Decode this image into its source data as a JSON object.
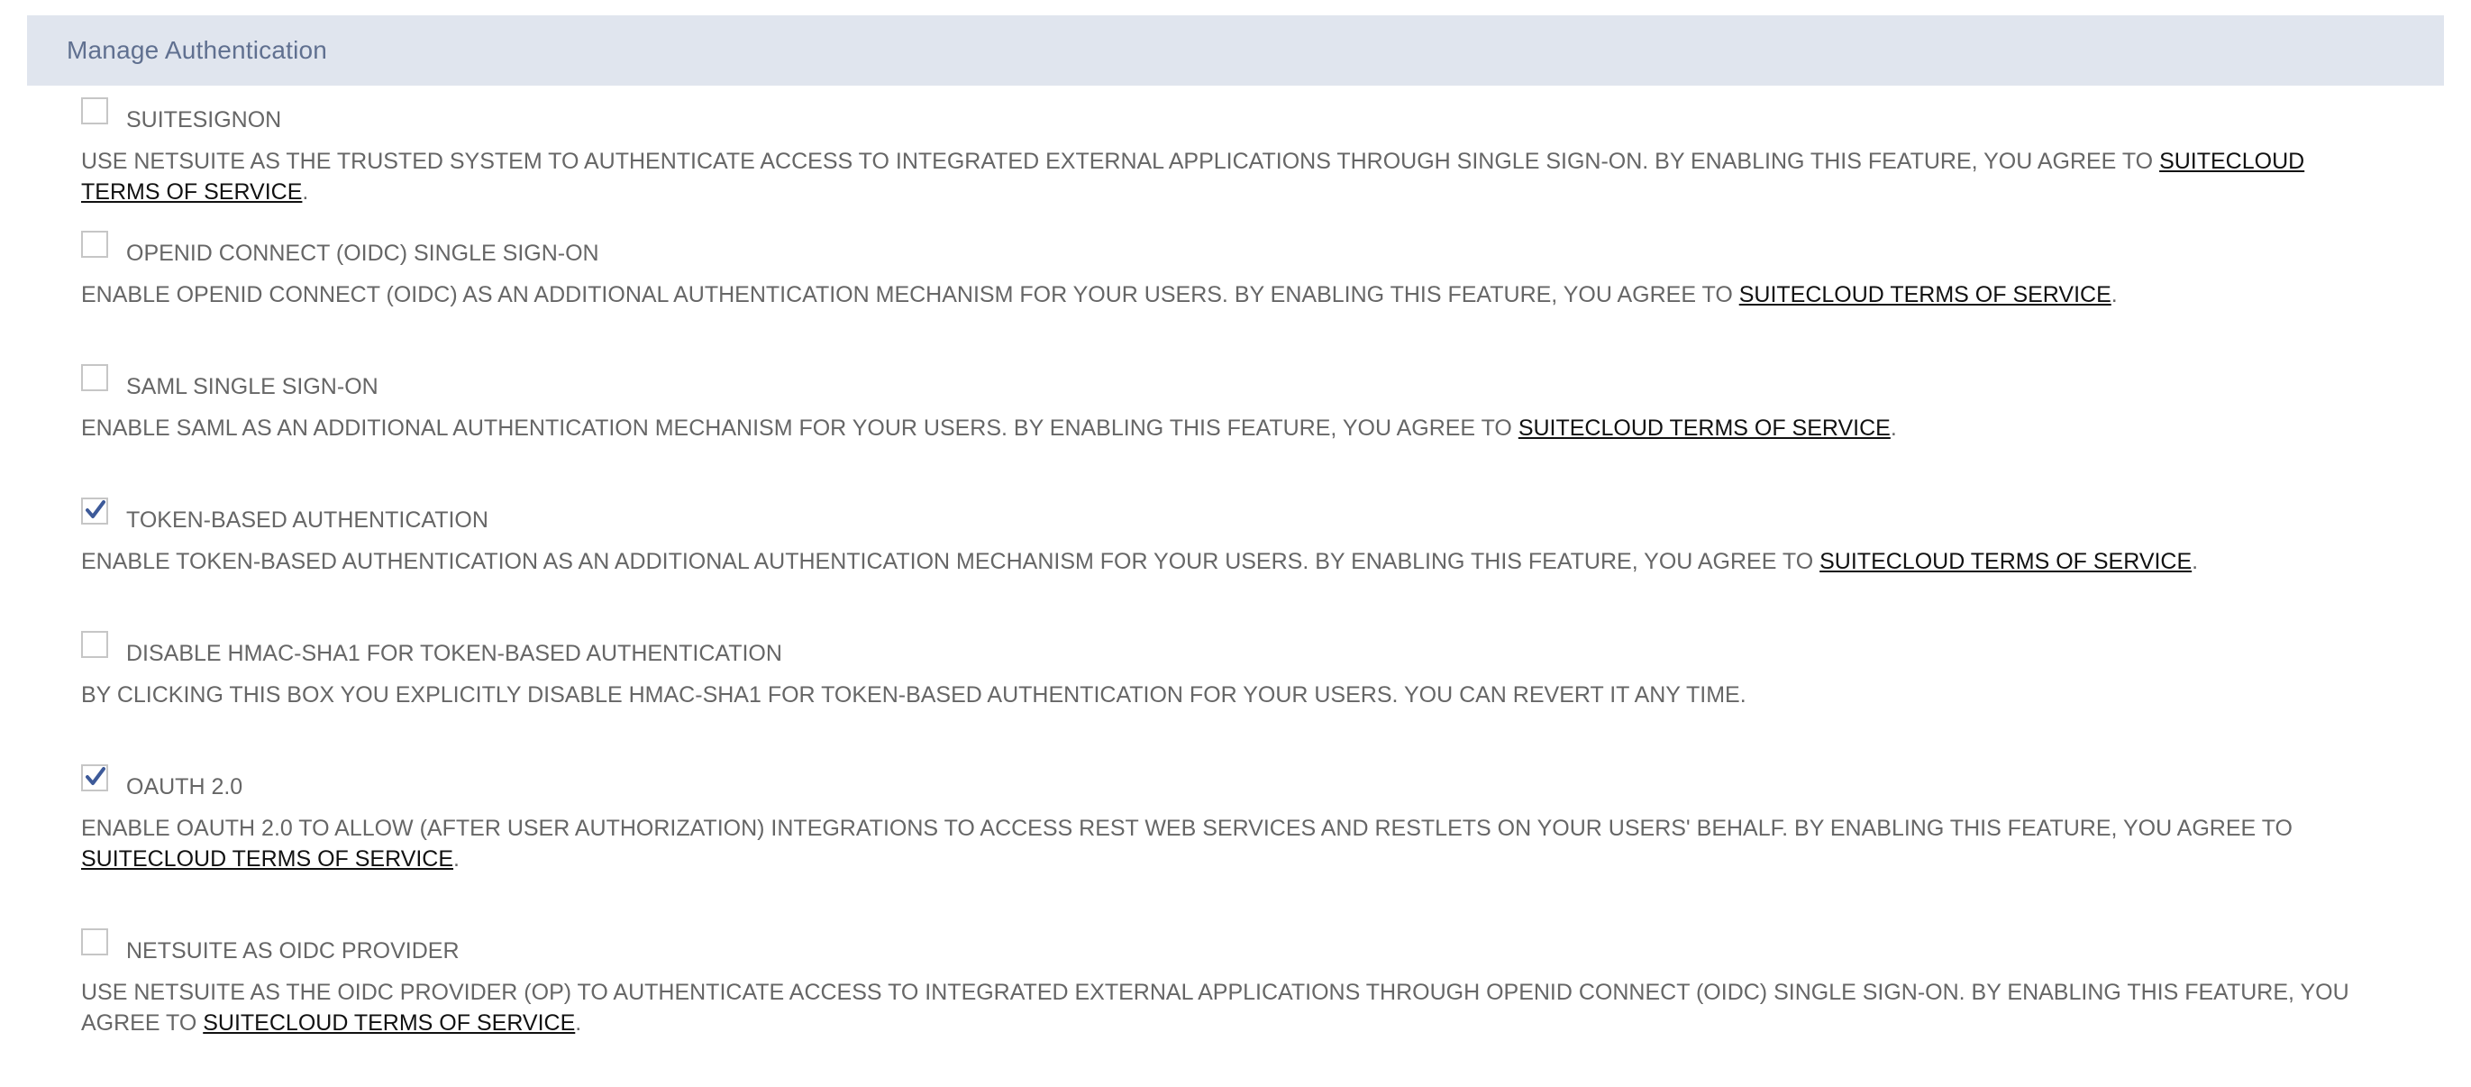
{
  "section": {
    "title": "Manage Authentication"
  },
  "link_text": "SUITECLOUD TERMS OF SERVICE",
  "features": [
    {
      "label": "SUITESIGNON",
      "checked": false,
      "desc": "USE NETSUITE AS THE TRUSTED SYSTEM TO AUTHENTICATE ACCESS TO INTEGRATED EXTERNAL APPLICATIONS THROUGH SINGLE SIGN-ON. BY ENABLING THIS FEATURE, YOU AGREE TO ",
      "link": "SUITECLOUD TERMS OF SERVICE",
      "suffix": "."
    },
    {
      "label": "OPENID CONNECT (OIDC) SINGLE SIGN-ON",
      "checked": false,
      "desc": "ENABLE OPENID CONNECT (OIDC) AS AN ADDITIONAL AUTHENTICATION MECHANISM FOR YOUR USERS. BY ENABLING THIS FEATURE, YOU AGREE TO ",
      "link": "SUITECLOUD TERMS OF SERVICE",
      "suffix": "."
    },
    {
      "label": "SAML SINGLE SIGN-ON",
      "checked": false,
      "desc": "ENABLE SAML AS AN ADDITIONAL AUTHENTICATION MECHANISM FOR YOUR USERS. BY ENABLING THIS FEATURE, YOU AGREE TO ",
      "link": "SUITECLOUD TERMS OF SERVICE",
      "suffix": "."
    },
    {
      "label": "TOKEN-BASED AUTHENTICATION",
      "checked": true,
      "desc": "ENABLE TOKEN-BASED AUTHENTICATION AS AN ADDITIONAL AUTHENTICATION MECHANISM FOR YOUR USERS. BY ENABLING THIS FEATURE, YOU AGREE TO ",
      "link": "SUITECLOUD TERMS OF SERVICE",
      "suffix": "."
    },
    {
      "label": "DISABLE HMAC-SHA1 FOR TOKEN-BASED AUTHENTICATION",
      "checked": false,
      "desc": "BY CLICKING THIS BOX YOU EXPLICITLY DISABLE HMAC-SHA1 FOR TOKEN-BASED AUTHENTICATION FOR YOUR USERS. YOU CAN REVERT IT ANY TIME.",
      "link": "",
      "suffix": ""
    },
    {
      "label": "OAUTH 2.0",
      "checked": true,
      "desc": "ENABLE OAUTH 2.0 TO ALLOW (AFTER USER AUTHORIZATION) INTEGRATIONS TO ACCESS REST WEB SERVICES AND RESTLETS ON YOUR USERS' BEHALF. BY ENABLING THIS FEATURE, YOU AGREE TO ",
      "link": "SUITECLOUD TERMS OF SERVICE",
      "suffix": "."
    },
    {
      "label": "NETSUITE AS OIDC PROVIDER",
      "checked": false,
      "desc": "USE NETSUITE AS THE OIDC PROVIDER (OP) TO AUTHENTICATE ACCESS TO INTEGRATED EXTERNAL APPLICATIONS THROUGH OPENID CONNECT (OIDC) SINGLE SIGN-ON. BY ENABLING THIS FEATURE, YOU AGREE TO ",
      "link": "SUITECLOUD TERMS OF SERVICE",
      "suffix": "."
    }
  ],
  "colors": {
    "header_bg": "#e0e5ee",
    "header_text": "#607090",
    "body_text": "#666666",
    "link_text": "#111111",
    "checkmark": "#3d5a99"
  }
}
